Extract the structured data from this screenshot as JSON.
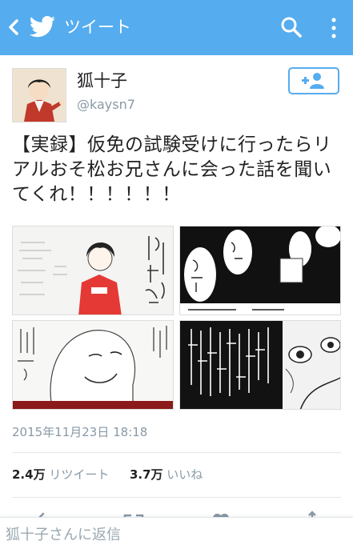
{
  "header": {
    "title": "ツイート",
    "icons": [
      "back-arrow-icon",
      "twitter-bird-icon",
      "search-icon",
      "more-vertical-icon"
    ]
  },
  "tweet": {
    "author_name": "狐十子",
    "author_handle": "@kaysn7",
    "text": "【実録】仮免の試験受けに行ったらリアルおそ松お兄さんに会った話を聞いてくれ！！！！！！",
    "timestamp": "2015年11月23日 18:18",
    "retweet_count": "2.4万",
    "retweet_label": "リツイート",
    "like_count": "3.7万",
    "like_label": "いいね"
  },
  "media": [
    {
      "alt": "manga-panel-1"
    },
    {
      "alt": "manga-panel-2"
    },
    {
      "alt": "manga-panel-3"
    },
    {
      "alt": "manga-panel-4"
    }
  ],
  "reply": {
    "placeholder": "狐十子さんに返信"
  },
  "colors": {
    "brand": "#55acee",
    "text": "#222222",
    "muted": "#8899a6"
  }
}
